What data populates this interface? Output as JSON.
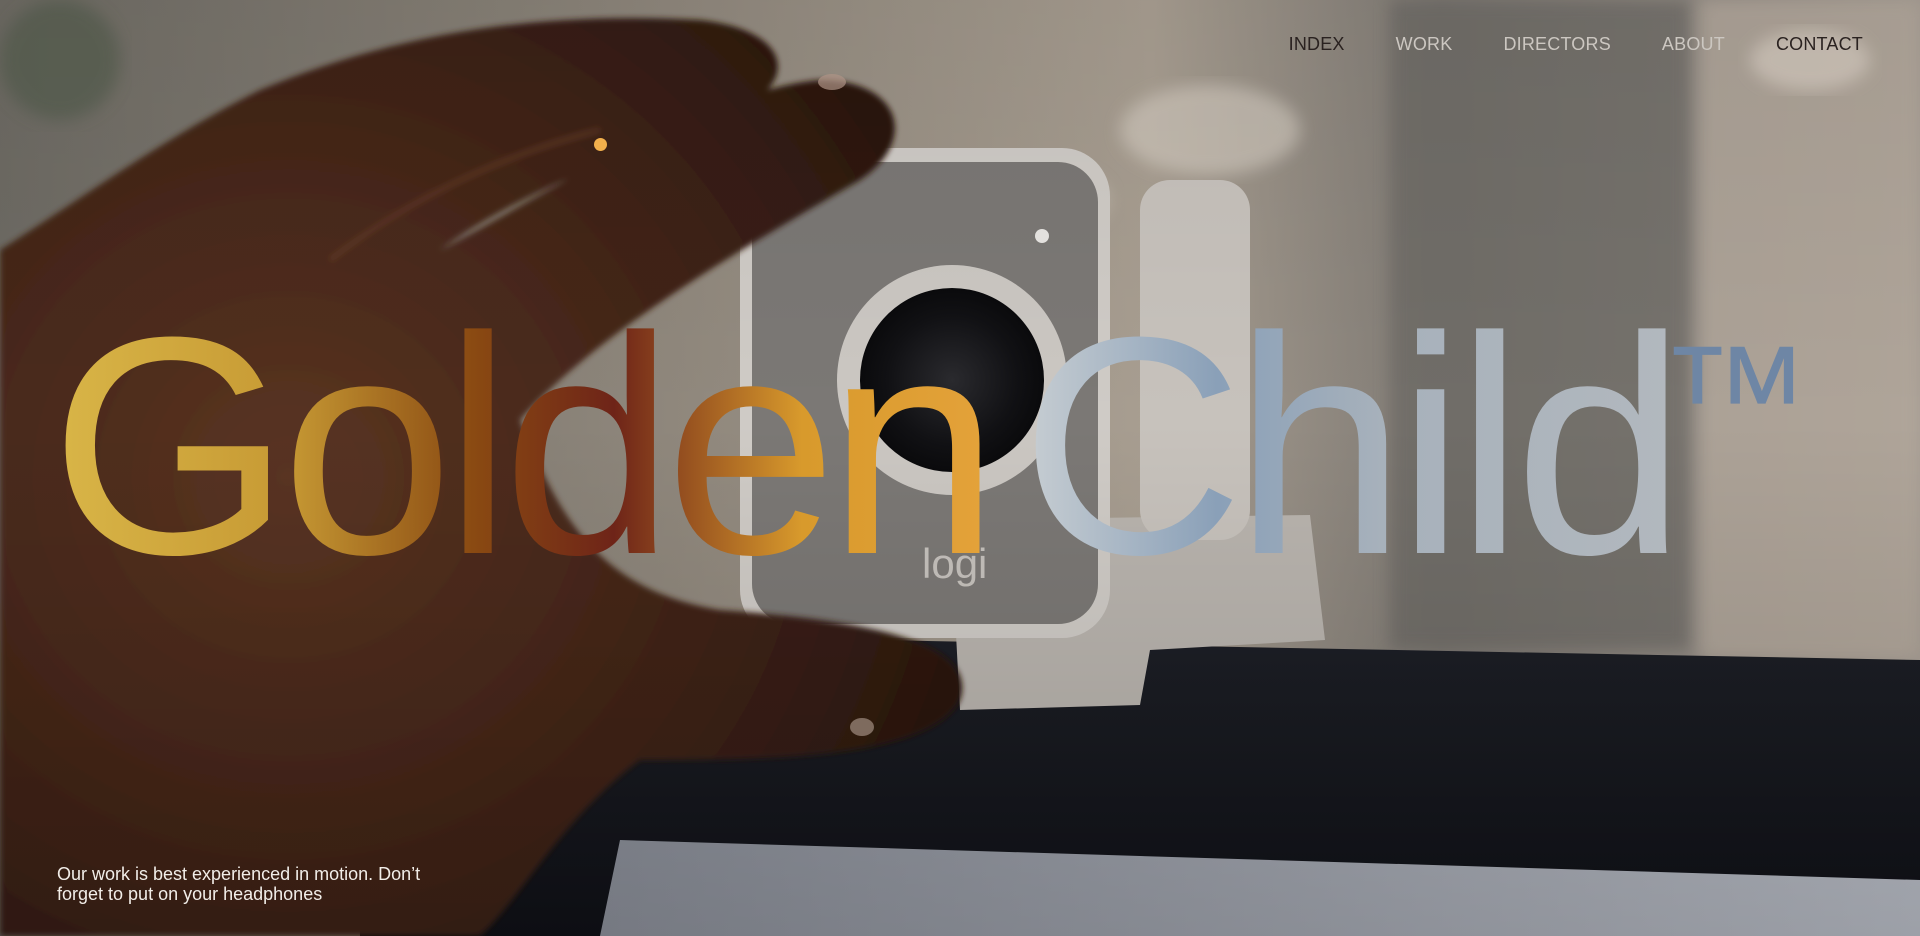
{
  "nav": {
    "items": [
      {
        "label": "INDEX"
      },
      {
        "label": "WORK"
      },
      {
        "label": "DIRECTORS"
      },
      {
        "label": "ABOUT"
      },
      {
        "label": "CONTACT"
      }
    ]
  },
  "hero": {
    "wordmark_gold": "Golden",
    "wordmark_silver": "Child",
    "trademark": "™",
    "camera_brand": "logi"
  },
  "footer": {
    "caption_line1": "Our work is best experienced in motion. Don’t",
    "caption_line2": "forget to put on your headphones"
  },
  "colors": {
    "accent_dot": "#f2b04c",
    "gold_light": "#d9b648",
    "gold_dark": "#8a4a12",
    "silver": "#a8b2bb",
    "steel_blue": "#6e86a5"
  }
}
